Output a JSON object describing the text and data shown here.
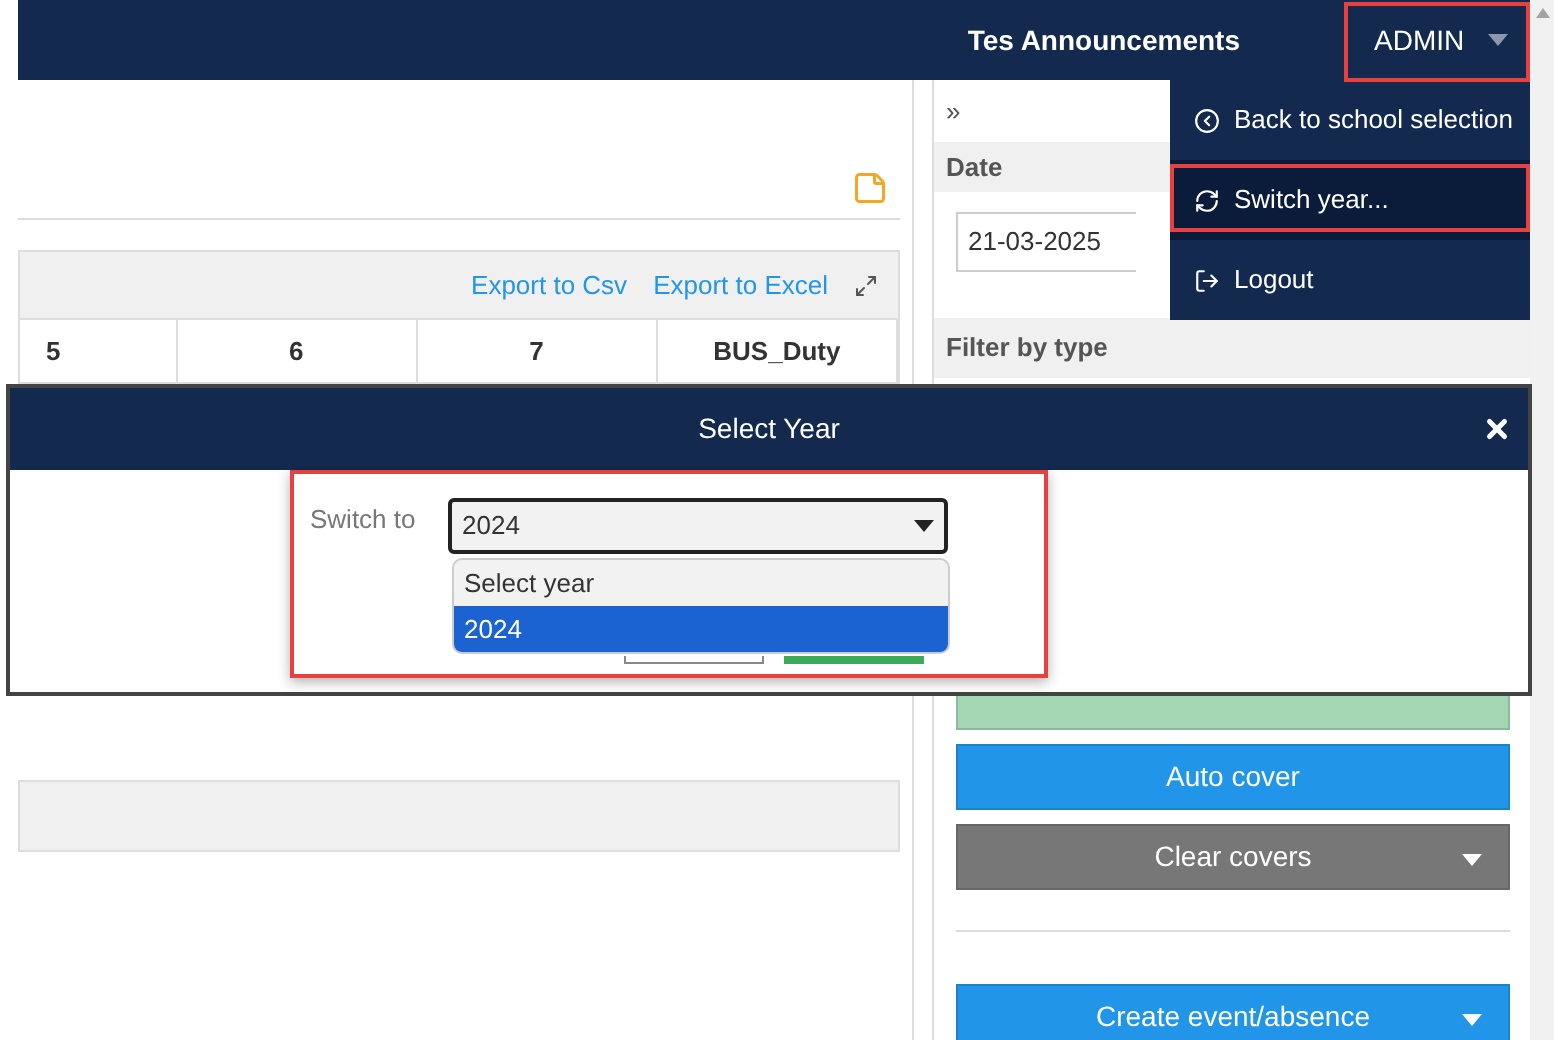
{
  "top_bar": {
    "title": "Tes Announcements",
    "user_menu": "ADMIN"
  },
  "user_dropdown": [
    {
      "label": "Back to school selection",
      "kind": "back",
      "selected": false
    },
    {
      "label": "Switch year...",
      "kind": "refresh",
      "selected": true
    },
    {
      "label": "Logout",
      "kind": "logout",
      "selected": false
    }
  ],
  "table": {
    "actions": [
      "Export to Csv",
      "Export to Excel"
    ],
    "columns": [
      "5",
      "6",
      "7",
      "BUS_Duty"
    ]
  },
  "side_panel": {
    "collapse": "»",
    "date_label": "Date",
    "date_value": "21-03-2025",
    "filter_label": "Filter by type",
    "buttons": [
      {
        "kind": "success",
        "menu": false
      },
      {
        "label": "Auto cover",
        "kind": "primary",
        "menu": false
      },
      {
        "label": "Clear covers",
        "kind": "secondary",
        "menu": true
      }
    ],
    "create_button": {
      "label": "Create event/absence",
      "kind": "primary",
      "menu": true
    }
  },
  "modal": {
    "title": "Select Year",
    "field_label": "Switch to",
    "value": "2024",
    "options": [
      {
        "label": "Select year",
        "selected": false
      },
      {
        "label": "2024",
        "selected": true
      }
    ]
  }
}
